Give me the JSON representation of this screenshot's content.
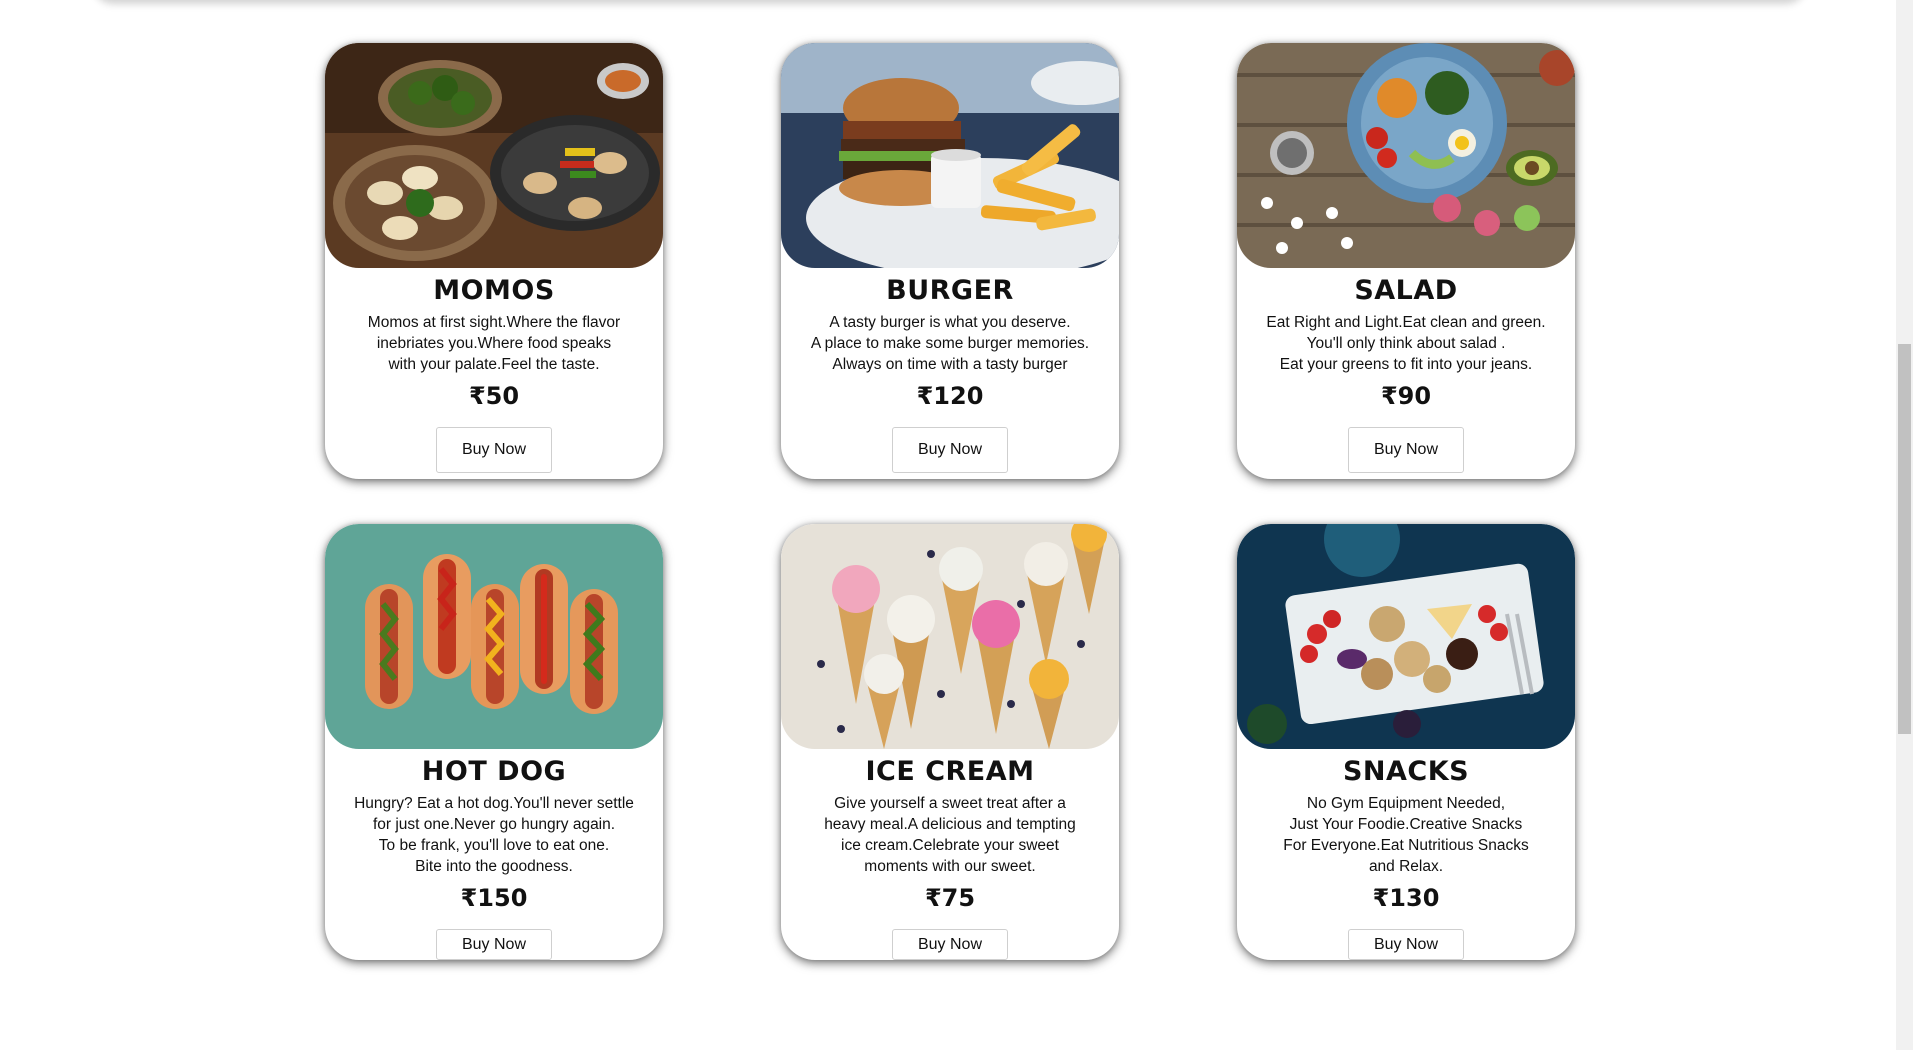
{
  "currency_symbol": "₹",
  "buy_label": "Buy Now",
  "cards": [
    {
      "title": "MOMOS",
      "description": "Momos at first sight.Where the flavor\ninebriates you.Where food speaks\nwith your palate.Feel the taste.",
      "price": "₹50",
      "image_icon": "momos-photo"
    },
    {
      "title": "BURGER",
      "description": "A tasty burger is what you deserve.\nA place to make some burger memories.\nAlways on time with a tasty burger",
      "price": "₹120",
      "image_icon": "burger-photo"
    },
    {
      "title": "SALAD",
      "description": "Eat Right and Light.Eat clean and green.\nYou'll only think about salad .\nEat your greens to fit into your jeans.",
      "price": "₹90",
      "image_icon": "salad-photo"
    },
    {
      "title": "HOT DOG",
      "description": "Hungry? Eat a hot dog.You'll never settle\nfor just one.Never go hungry again.\nTo be frank, you'll love to eat one.\nBite into the goodness.",
      "price": "₹150",
      "image_icon": "hotdog-photo"
    },
    {
      "title": "ICE CREAM",
      "description": "Give yourself a sweet treat after a\nheavy meal.A delicious and tempting\nice cream.Celebrate your sweet\nmoments with our sweet.",
      "price": "₹75",
      "image_icon": "icecream-photo"
    },
    {
      "title": "SNACKS",
      "description": "No Gym Equipment Needed,\nJust Your Foodie.Creative Snacks\nFor Everyone.Eat Nutritious Snacks\nand Relax.",
      "price": "₹130",
      "image_icon": "snacks-photo"
    }
  ],
  "colors": {
    "page_background": "#ffffff",
    "text": "#111111",
    "button_border": "#cfcfcf",
    "scrollbar_thumb": "#c1c1c1",
    "scrollbar_track": "#f1f1f1"
  }
}
